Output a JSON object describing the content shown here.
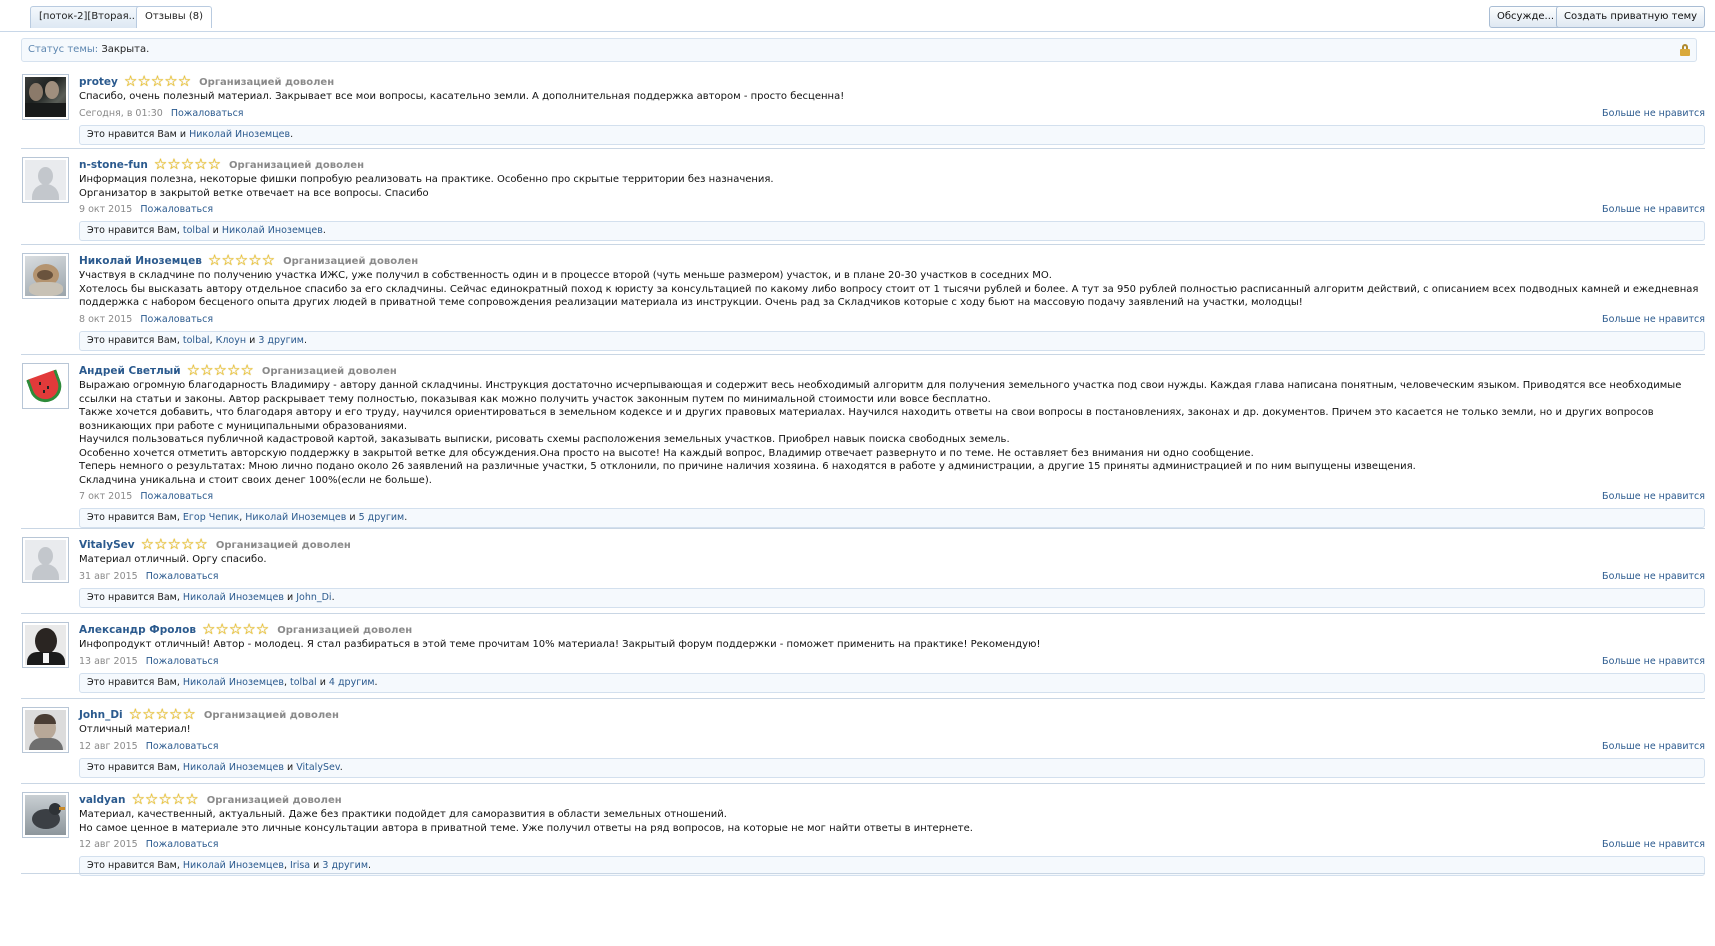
{
  "tabs": [
    {
      "label": "[поток-2][Вторая..."
    },
    {
      "label": "Отзывы (8)"
    }
  ],
  "toolbar": {
    "discuss_label": "Обсужде...",
    "private_topic_label": "Создать приватную тему"
  },
  "status": {
    "label": "Статус темы:",
    "value": "Закрыта."
  },
  "common": {
    "stars": "☆☆☆☆☆",
    "rating_text": "Организацией доволен",
    "report_label": "Пожаловаться",
    "unlike_label": "Больше не нравится",
    "likes_prefix": "Это нравится Вам",
    "and_word": "и"
  },
  "reviews": [
    {
      "username": "protey",
      "avatar": "photo-men-avatar",
      "text": [
        "Спасибо, очень полезный материал. Закрывает все мои вопросы, касательно земли. А дополнительная поддержка автором - просто бесценна!"
      ],
      "date": "Сегодня, в 01:30",
      "likes_intro": "Это нравится Вам и",
      "likes_links": [
        "Николай Иноземцев"
      ],
      "likes_outro": "."
    },
    {
      "username": "n-stone-fun",
      "avatar": "default-avatar",
      "text": [
        "Информация полезна, некоторые фишки попробую реализовать на практике. Особенно про скрытые территории без назначения.",
        "Организатор в закрытой ветке отвечает на все вопросы. Спасибо"
      ],
      "date": "9 окт 2015",
      "likes_intro": "Это нравится Вам,",
      "likes_links": [
        "tolbal",
        "Николай Иноземцев"
      ],
      "likes_outro": "."
    },
    {
      "username": "Николай Иноземцев",
      "avatar": "photo-cat-avatar",
      "text": [
        "Участвуя в складчине по получению участка ИЖС, уже получил в собственность один и в процессе второй (чуть меньше размером) участок, и в плане 20-30 участков в соседних МО.",
        "Хотелось бы высказать автору отдельное спасибо за его складчины. Сейчас единократный поход к юристу за консультацией по какому либо вопросу стоит от 1 тысячи рублей и более. А тут за 950 рублей полностью расписанный алгоритм действий, с описанием всех подводных камней и ежедневная поддержка с набором бесценого опыта других людей в приватной теме сопровождения реализации материала из инструкции. Очень рад за Складчиков которые с ходу бьют на массовую подачу заявлений на участки, молодцы!"
      ],
      "date": "8 окт 2015",
      "likes_intro": "Это нравится Вам,",
      "likes_links": [
        "tolbal",
        "Клоун",
        "3 другим"
      ],
      "likes_outro": "."
    },
    {
      "username": "Андрей Светлый",
      "avatar": "watermelon-avatar",
      "text": [
        "Выражаю огромную благодарность Владимиру - автору данной складчины. Инструкция достаточно исчерпывающая и содержит весь необходимый алгоритм для получения земельного участка под свои нужды. Каждая глава написана понятным, человеческим языком. Приводятся все необходимые ссылки на статьи и законы. Автор раскрывает тему полностью, показывая как можно получить участок законным путем по минимальной стоимости или вовсе бесплатно.",
        "Также хочется добавить, что благодаря автору и его труду, научился ориентироваться в земельном кодексе и и других правовых материалах. Научился находить ответы на свои вопросы в постановлениях, законах и др. документов. Причем это касается не только земли, но и других вопросов возникающих при работе с муниципальными образованиями.",
        "Научился пользоваться публичной кадастровой картой, заказывать выписки, рисовать схемы расположения земельных участков. Приобрел навык поиска свободных земель.",
        "Особенно хочется отметить авторскую поддержку в закрытой ветке для обсуждения.Она просто на высоте! На каждый вопрос, Владимир отвечает развернуто и по теме. Не оставляет без внимания ни одно сообщение.",
        "Теперь немного о результатах: Мною лично подано около 26 заявлений на различные участки, 5 отклонили, по причине наличия хозяина. 6 находятся в работе у администрации, а другие 15 приняты администрацией и по ним выпущены извещения.",
        "Складчина уникальна и стоит своих денег 100%(если не больше)."
      ],
      "date": "7 окт 2015",
      "likes_intro": "Это нравится Вам,",
      "likes_links": [
        "Егор Чепик",
        "Николай Иноземцев",
        "5 другим"
      ],
      "likes_outro": "."
    },
    {
      "username": "VitalySev",
      "avatar": "default-avatar",
      "text": [
        "Материал отличный. Оргу спасибо."
      ],
      "date": "31 авг 2015",
      "likes_intro": "Это нравится Вам,",
      "likes_links": [
        "Николай Иноземцев",
        "John_Di"
      ],
      "likes_outro": "."
    },
    {
      "username": "Александр Фролов",
      "avatar": "photo-man-avatar",
      "text": [
        "Инфопродукт отличный! Автор - молодец. Я стал разбираться в этой теме прочитам 10% материала! Закрытый форум поддержки - поможет применить на практике! Рекомендую!"
      ],
      "date": "13 авг 2015",
      "likes_intro": "Это нравится Вам,",
      "likes_links": [
        "Николай Иноземцев",
        "tolbal",
        "4 другим"
      ],
      "likes_outro": "."
    },
    {
      "username": "John_Di",
      "avatar": "photo-child-avatar",
      "text": [
        "Отличный материал!"
      ],
      "date": "12 авг 2015",
      "likes_intro": "Это нравится Вам,",
      "likes_links": [
        "Николай Иноземцев",
        "VitalySev"
      ],
      "likes_outro": "."
    },
    {
      "username": "valdyan",
      "avatar": "photo-bird-avatar",
      "text": [
        "Материал, качественный, актуальный. Даже без практики подойдет для саморазвития в области земельных отношений.",
        "Но самое ценное в материале это личные консультации автора в приватной теме. Уже получил ответы на ряд вопросов, на которые не мог найти ответы в интернете."
      ],
      "date": "12 авг 2015",
      "likes_intro": "Это нравится Вам,",
      "likes_links": [
        "Николай Иноземцев",
        "Irisa",
        "3 другим"
      ],
      "likes_outro": "."
    }
  ]
}
